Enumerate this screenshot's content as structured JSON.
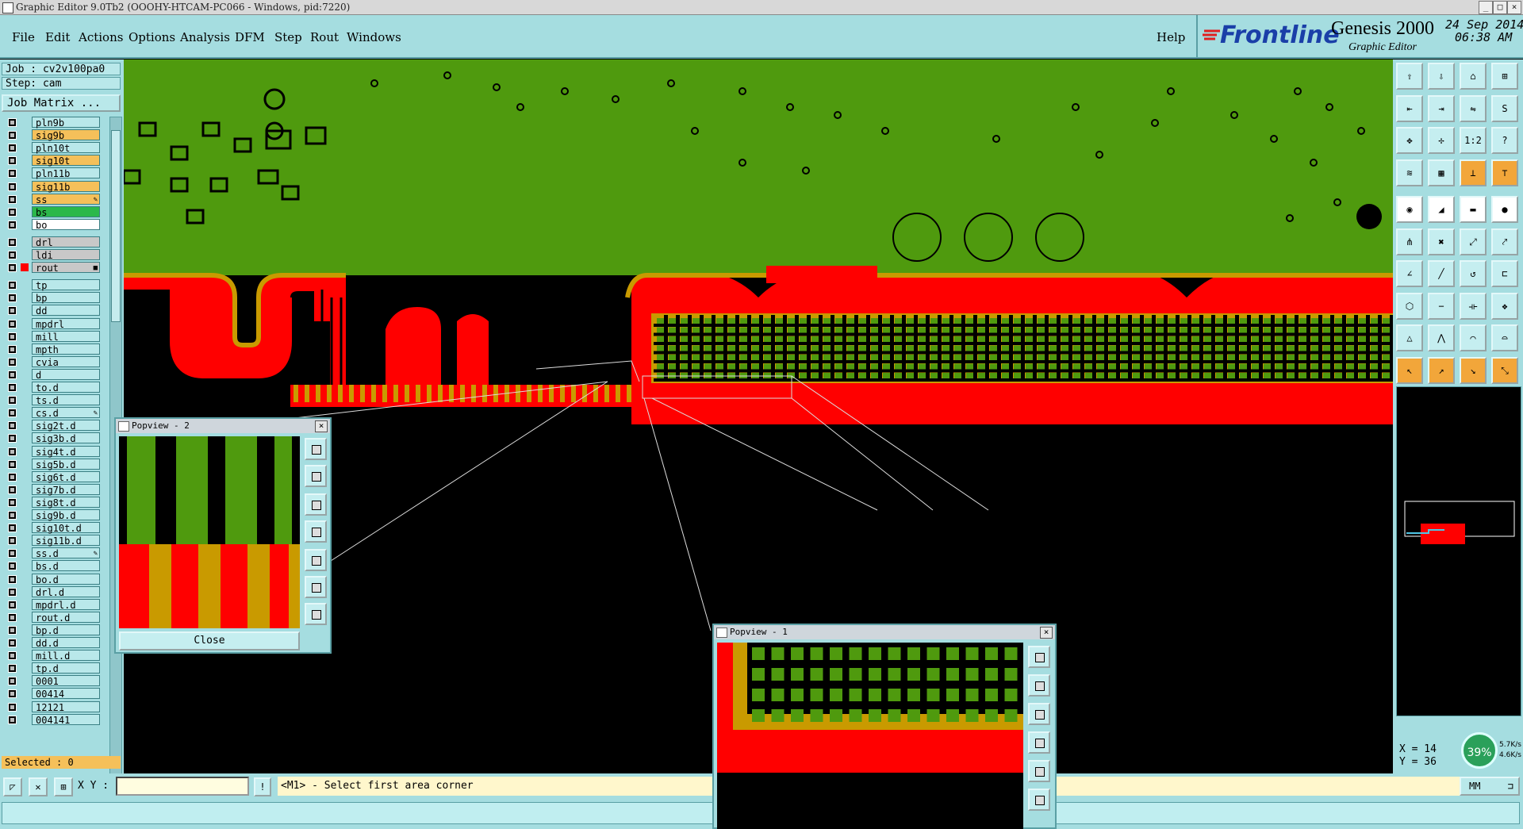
{
  "window": {
    "title": "Graphic Editor 9.0Tb2 (OOOHY-HTCAM-PC066 - Windows, pid:7220)",
    "minimize": "_",
    "maximize": "□",
    "close": "×"
  },
  "menu": {
    "items": [
      "File",
      "Edit",
      "Actions",
      "Options",
      "Analysis",
      "DFM",
      "Step",
      "Rout",
      "Windows"
    ],
    "help": "Help"
  },
  "brand": {
    "logo": "Frontline",
    "product": "Genesis 2000",
    "subtitle": "Graphic Editor",
    "date": "24 Sep 2014",
    "time": "06:38 AM"
  },
  "job": {
    "job_line": "Job : cv2v100pa0",
    "step_line": "Step: cam",
    "job_matrix": "Job Matrix ..."
  },
  "layers": [
    {
      "name": "pln9b",
      "bg": "#b9e8ea"
    },
    {
      "name": "sig9b",
      "bg": "#f5c05a"
    },
    {
      "name": "pln10t",
      "bg": "#b9e8ea"
    },
    {
      "name": "sig10t",
      "bg": "#f5c05a"
    },
    {
      "name": "pln11b",
      "bg": "#b9e8ea"
    },
    {
      "name": "sig11b",
      "bg": "#f5c05a"
    },
    {
      "name": "ss",
      "bg": "#f5c05a",
      "flag": "✎"
    },
    {
      "name": "bs",
      "bg": "#2bb84a"
    },
    {
      "name": "bo",
      "bg": "#ffffff"
    },
    {
      "name": "drl",
      "bg": "#c8c8c8"
    },
    {
      "name": "ldi",
      "bg": "#c8c8c8"
    },
    {
      "name": "rout",
      "bg": "#c8c8c8",
      "active": true,
      "flag": "■"
    },
    {
      "name": "tp",
      "bg": "#b9e8ea"
    },
    {
      "name": "bp",
      "bg": "#b9e8ea"
    },
    {
      "name": "dd",
      "bg": "#b9e8ea"
    },
    {
      "name": "mpdrl",
      "bg": "#b9e8ea"
    },
    {
      "name": "mill",
      "bg": "#b9e8ea"
    },
    {
      "name": "mpth",
      "bg": "#b9e8ea"
    },
    {
      "name": "cvia",
      "bg": "#b9e8ea"
    },
    {
      "name": "d",
      "bg": "#b9e8ea"
    },
    {
      "name": "to.d",
      "bg": "#b9e8ea"
    },
    {
      "name": "ts.d",
      "bg": "#b9e8ea"
    },
    {
      "name": "cs.d",
      "bg": "#b9e8ea",
      "flag": "✎"
    },
    {
      "name": "sig2t.d",
      "bg": "#b9e8ea"
    },
    {
      "name": "sig3b.d",
      "bg": "#b9e8ea"
    },
    {
      "name": "sig4t.d",
      "bg": "#b9e8ea"
    },
    {
      "name": "sig5b.d",
      "bg": "#b9e8ea"
    },
    {
      "name": "sig6t.d",
      "bg": "#b9e8ea"
    },
    {
      "name": "sig7b.d",
      "bg": "#b9e8ea"
    },
    {
      "name": "sig8t.d",
      "bg": "#b9e8ea"
    },
    {
      "name": "sig9b.d",
      "bg": "#b9e8ea"
    },
    {
      "name": "sig10t.d",
      "bg": "#b9e8ea"
    },
    {
      "name": "sig11b.d",
      "bg": "#b9e8ea"
    },
    {
      "name": "ss.d",
      "bg": "#b9e8ea",
      "flag": "✎"
    },
    {
      "name": "bs.d",
      "bg": "#b9e8ea"
    },
    {
      "name": "bo.d",
      "bg": "#b9e8ea"
    },
    {
      "name": "drl.d",
      "bg": "#b9e8ea"
    },
    {
      "name": "mpdrl.d",
      "bg": "#b9e8ea"
    },
    {
      "name": "rout.d",
      "bg": "#b9e8ea"
    },
    {
      "name": "bp.d",
      "bg": "#b9e8ea"
    },
    {
      "name": "dd.d",
      "bg": "#b9e8ea"
    },
    {
      "name": "mill.d",
      "bg": "#b9e8ea"
    },
    {
      "name": "tp.d",
      "bg": "#b9e8ea"
    },
    {
      "name": "0001",
      "bg": "#b9e8ea"
    },
    {
      "name": "00414",
      "bg": "#b9e8ea"
    },
    {
      "name": "12121",
      "bg": "#b9e8ea"
    },
    {
      "name": "004141",
      "bg": "#b9e8ea"
    }
  ],
  "selected": "Selected : 0",
  "popview2": {
    "title": "Popview - 2",
    "close_x": "×",
    "close_label": "Close"
  },
  "popview1": {
    "title": "Popview - 1",
    "close_x": "×"
  },
  "tools": [
    {
      "icon": "open-job-icon",
      "label": "⇪"
    },
    {
      "icon": "save-icon",
      "label": "⇩"
    },
    {
      "icon": "home-icon",
      "label": "⌂"
    },
    {
      "icon": "windows-icon",
      "label": "⊞"
    },
    {
      "icon": "prev-step-icon",
      "label": "⇤"
    },
    {
      "icon": "next-step-icon",
      "label": "⇥"
    },
    {
      "icon": "swap-icon",
      "label": "⇋"
    },
    {
      "icon": "snap-icon",
      "label": "S"
    },
    {
      "icon": "zoom-fit-icon",
      "label": "✥"
    },
    {
      "icon": "zoom-pan-icon",
      "label": "✢"
    },
    {
      "icon": "scale-icon",
      "label": "1:2"
    },
    {
      "icon": "query-icon",
      "label": "?"
    },
    {
      "icon": "layers-icon",
      "label": "≋"
    },
    {
      "icon": "grid-icon",
      "label": "▦"
    },
    {
      "icon": "measure-icon",
      "label": "⊥",
      "hl": true
    },
    {
      "icon": "route-icon",
      "label": "⊤",
      "hl": true
    },
    {
      "icon": "pad-icon",
      "label": "◉",
      "wh": true
    },
    {
      "icon": "line-icon",
      "label": "◢",
      "wh": true
    },
    {
      "icon": "ruler-icon",
      "label": "▬",
      "wh": true
    },
    {
      "icon": "dot-icon",
      "label": "●",
      "wh": true
    },
    {
      "icon": "connect-icon",
      "label": "⋔"
    },
    {
      "icon": "delete-icon",
      "label": "✖"
    },
    {
      "icon": "move-icon",
      "label": "⤢"
    },
    {
      "icon": "copy-icon",
      "label": "⤤"
    },
    {
      "icon": "angle-icon",
      "label": "∠"
    },
    {
      "icon": "edge-icon",
      "label": "╱"
    },
    {
      "icon": "arc-icon",
      "label": "↺"
    },
    {
      "icon": "fill-icon",
      "label": "⊏"
    },
    {
      "icon": "polygon-icon",
      "label": "⬡"
    },
    {
      "icon": "cut-icon",
      "label": "−"
    },
    {
      "icon": "resize-icon",
      "label": "⟛"
    },
    {
      "icon": "group-icon",
      "label": "❖"
    },
    {
      "icon": "triangle-icon",
      "label": "△"
    },
    {
      "icon": "peak-icon",
      "label": "⋀"
    },
    {
      "icon": "arch-icon",
      "label": "⌒"
    },
    {
      "icon": "bridge-icon",
      "label": "⌓"
    },
    {
      "icon": "select-icon",
      "label": "↖",
      "hl": true
    },
    {
      "icon": "select-add-icon",
      "label": "↗",
      "hl": true
    },
    {
      "icon": "select-edit-icon",
      "label": "↘",
      "hl": true
    },
    {
      "icon": "select-all-icon",
      "label": "⤡",
      "hl": true
    }
  ],
  "coords": {
    "x": "X = 14",
    "y": "Y = 36"
  },
  "badge": {
    "percent": "39%"
  },
  "net": {
    "up": "5.7K/s",
    "down": "4.6K/s"
  },
  "status": {
    "xy_label": "X Y :",
    "prompt": "<M1> - Select first area corner",
    "units": "MM"
  },
  "colors": {
    "board": "#4f9a0e",
    "copper": "#ff0000",
    "outline": "#c99a00",
    "panel": "#a5dde0"
  }
}
